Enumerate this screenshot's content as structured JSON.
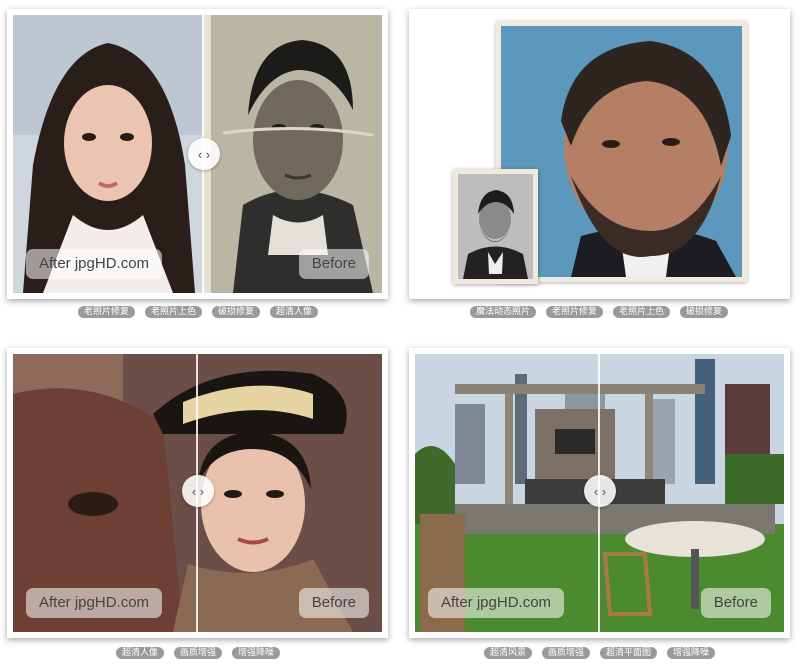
{
  "cards": [
    {
      "after_label": "After jpgHD.com",
      "before_label": "Before",
      "tags": [
        "老照片修复",
        "老照片上色",
        "破损修复",
        "超清人像"
      ]
    },
    {
      "tags": [
        "魔法动态照片",
        "老照片修复",
        "老照片上色",
        "破损修复"
      ]
    },
    {
      "after_label": "After jpgHD.com",
      "before_label": "Before",
      "tags": [
        "超清人像",
        "画质增强",
        "增强降噪"
      ]
    },
    {
      "after_label": "After jpgHD.com",
      "before_label": "Before",
      "tags": [
        "超清风景",
        "画质增强",
        "超清平面图",
        "增强降噪"
      ]
    }
  ],
  "icons": {
    "compare_handle": "chevron-left-right-icon"
  }
}
